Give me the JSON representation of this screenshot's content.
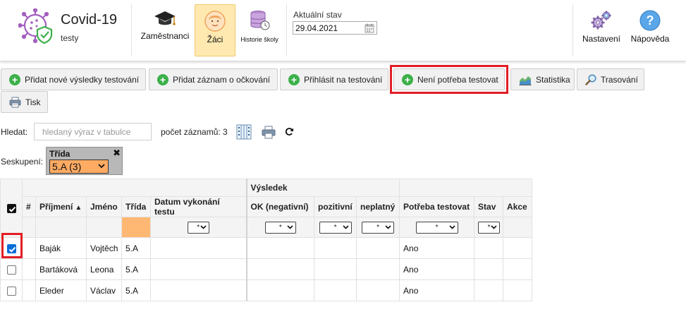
{
  "app": {
    "title": "Covid-19",
    "subtitle": "testy"
  },
  "nav": {
    "employees": "Zaměstnanci",
    "pupils": "Žáci",
    "history": "Historie školy",
    "settings": "Nastavení",
    "help": "Nápověda"
  },
  "state": {
    "label": "Aktuální stav",
    "date": "29.04.2021"
  },
  "toolbar": {
    "add_results": "Přidat nové výsledky testování",
    "add_vaccination": "Přidat záznam o očkování",
    "register_testing": "Přihlásit na testování",
    "no_testing_needed": "Není potřeba testovat",
    "statistics": "Statistika",
    "tracing": "Trasování",
    "print": "Tisk"
  },
  "search": {
    "label": "Hledat:",
    "placeholder": "hledaný výraz v tabulce",
    "count_label": "počet záznamů: 3"
  },
  "grouping": {
    "label": "Seskupení:",
    "field": "Třída",
    "value": "5.A (3)"
  },
  "table": {
    "group_header": "Výsledek",
    "columns": {
      "num": "#",
      "surname": "Příjmení",
      "name": "Jméno",
      "class": "Třída",
      "date": "Datum vykonání testu",
      "ok": "OK (negativní)",
      "positive": "pozitivní",
      "invalid": "neplatný",
      "need": "Potřeba testovat",
      "state": "Stav",
      "action": "Akce"
    },
    "filter_value": "*",
    "rows": [
      {
        "surname": "Baják",
        "name": "Vojtěch",
        "class": "5.A",
        "need": "Ano",
        "checked": true
      },
      {
        "surname": "Bartáková",
        "name": "Leona",
        "class": "5.A",
        "need": "Ano",
        "checked": false
      },
      {
        "surname": "Eleder",
        "name": "Václav",
        "class": "5.A",
        "need": "Ano",
        "checked": false
      }
    ]
  },
  "colors": {
    "accent_green": "#3cb04a",
    "highlight_red": "#e11e24",
    "active_nav": "#ffe9b0",
    "group_select": "#ffab63",
    "need_text": "#d4141c"
  }
}
